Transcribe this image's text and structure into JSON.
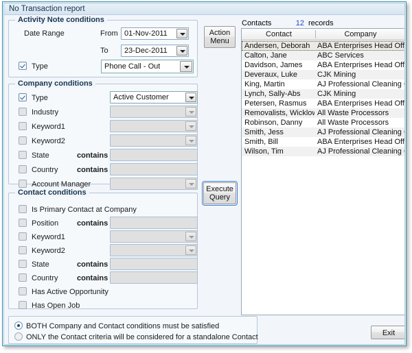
{
  "window": {
    "title": "No Transaction report"
  },
  "activity_note": {
    "legend": "Activity Note conditions",
    "date_range_label": "Date Range",
    "from_label": "From",
    "from_value": "01-Nov-2011",
    "to_label": "To",
    "to_value": "23-Dec-2011",
    "type_label": "Type",
    "type_checked": true,
    "type_value": "Phone Call - Out"
  },
  "company": {
    "legend": "Company conditions",
    "rows": [
      {
        "label": "Type",
        "checked": true,
        "op": "",
        "value": "Active Customer",
        "kind": "combo",
        "enabled": true
      },
      {
        "label": "Industry",
        "checked": false,
        "op": "",
        "value": "",
        "kind": "combo",
        "enabled": false
      },
      {
        "label": "Keyword1",
        "checked": false,
        "op": "",
        "value": "",
        "kind": "combo",
        "enabled": false
      },
      {
        "label": "Keyword2",
        "checked": false,
        "op": "",
        "value": "",
        "kind": "combo",
        "enabled": false
      },
      {
        "label": "State",
        "checked": false,
        "op": "contains",
        "value": "",
        "kind": "text",
        "enabled": false
      },
      {
        "label": "Country",
        "checked": false,
        "op": "contains",
        "value": "",
        "kind": "text",
        "enabled": false
      },
      {
        "label": "Account Manager",
        "checked": false,
        "op": "",
        "value": "",
        "kind": "combo",
        "enabled": false
      }
    ]
  },
  "contact_conditions": {
    "legend": "Contact conditions",
    "rows": [
      {
        "label": "Is Primary Contact at Company",
        "checked": false,
        "op": "",
        "value": "",
        "kind": "none",
        "enabled": false
      },
      {
        "label": "Position",
        "checked": false,
        "op": "contains",
        "value": "",
        "kind": "text",
        "enabled": false
      },
      {
        "label": "Keyword1",
        "checked": false,
        "op": "",
        "value": "",
        "kind": "combo",
        "enabled": false
      },
      {
        "label": "Keyword2",
        "checked": false,
        "op": "",
        "value": "",
        "kind": "combo",
        "enabled": false
      },
      {
        "label": "State",
        "checked": false,
        "op": "contains",
        "value": "",
        "kind": "text",
        "enabled": false
      },
      {
        "label": "Country",
        "checked": false,
        "op": "contains",
        "value": "",
        "kind": "text",
        "enabled": false
      },
      {
        "label": "Has Active Opportunity",
        "checked": false,
        "op": "",
        "value": "",
        "kind": "none",
        "enabled": false
      },
      {
        "label": "Has Open Job",
        "checked": false,
        "op": "",
        "value": "",
        "kind": "none",
        "enabled": false
      }
    ]
  },
  "buttons": {
    "action_menu_line1": "Action",
    "action_menu_line2": "Menu",
    "execute_query_line1": "Execute",
    "execute_query_line2": "Query",
    "exit": "Exit"
  },
  "contacts": {
    "panel_label": "Contacts",
    "record_count": "12",
    "records_word": "records",
    "columns": [
      "Contact",
      "Company"
    ],
    "rows": [
      {
        "contact": "Andersen, Deborah",
        "company": "ABA Enterprises Head Office",
        "selected": true
      },
      {
        "contact": "Calton, Jane",
        "company": "ABC Services",
        "selected": false
      },
      {
        "contact": "Davidson, James",
        "company": "ABA Enterprises Head Office",
        "selected": false
      },
      {
        "contact": "Deveraux, Luke",
        "company": "CJK Mining",
        "selected": false
      },
      {
        "contact": "King, Martin",
        "company": "AJ Professional Cleaning Group",
        "selected": false
      },
      {
        "contact": "Lynch, Sally-Abs",
        "company": "CJK Mining",
        "selected": false
      },
      {
        "contact": "Petersen, Rasmus",
        "company": "ABA Enterprises Head Office",
        "selected": false
      },
      {
        "contact": "Removalists, Wicklow",
        "company": "All Waste Processors",
        "selected": false
      },
      {
        "contact": "Robinson, Danny",
        "company": "All Waste Processors",
        "selected": false
      },
      {
        "contact": "Smith, Jess",
        "company": "AJ Professional Cleaning Group",
        "selected": false
      },
      {
        "contact": "Smith, Bill",
        "company": "ABA Enterprises Head Office",
        "selected": false
      },
      {
        "contact": "Wilson, Tim",
        "company": "AJ Professional Cleaning Group",
        "selected": false
      }
    ]
  },
  "scope_options": {
    "options": [
      {
        "label": "BOTH Company and Contact conditions must be satisfied",
        "selected": true
      },
      {
        "label": "ONLY the Contact criteria will be considered for a standalone Contact",
        "selected": false
      }
    ]
  },
  "colors": {
    "frame_border": "#3c8ca8",
    "window_bg": "#f2f6fb",
    "group_border": "#b4c6d8",
    "accent_count": "#2244bb",
    "focus_outline": "#3b7fd4"
  }
}
